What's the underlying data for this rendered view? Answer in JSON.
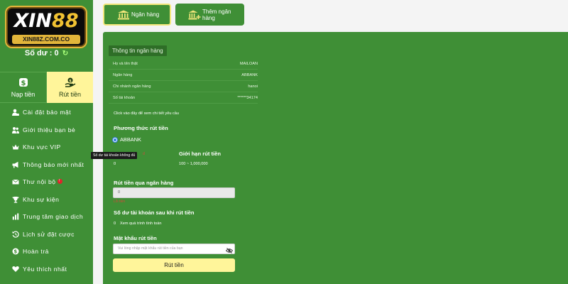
{
  "logo": {
    "brand_main": "XIN",
    "brand_num": "88",
    "domain": "XIN88Z.COM.CO"
  },
  "balance": {
    "label": "Số dư : 0",
    "refresh_icon": "refresh-icon"
  },
  "tabs": [
    {
      "label": "Nạp tiền",
      "icon": "dollar-coin-icon"
    },
    {
      "label": "Rút tiền",
      "icon": "hand-money-icon"
    }
  ],
  "menu": [
    {
      "label": "Cài đặt bảo mật",
      "icon": "user-lock-icon"
    },
    {
      "label": "Giới thiệu bạn bè",
      "icon": "users-icon"
    },
    {
      "label": "Khu vực VIP",
      "icon": "crown-icon"
    },
    {
      "label": "Thông báo mới nhất",
      "icon": "megaphone-icon"
    },
    {
      "label": "Thư nội bộ",
      "icon": "envelope-icon",
      "badge": "!"
    },
    {
      "label": "Khu sự kiện",
      "icon": "trophy-icon"
    },
    {
      "label": "Trung tâm giao dịch",
      "icon": "chart-icon"
    },
    {
      "label": "Lịch sử đặt cược",
      "icon": "history-icon"
    },
    {
      "label": "Hoàn trả",
      "icon": "coin-return-icon"
    },
    {
      "label": "Yêu thích nhất",
      "icon": "heart-icon"
    }
  ],
  "top_buttons": [
    {
      "label": "Ngân hàng",
      "icon": "bank-icon"
    },
    {
      "label": "Thêm ngân hàng",
      "icon": "bank-add-icon"
    }
  ],
  "bank_info": {
    "section_title": "Thông tin ngân hàng",
    "rows": [
      {
        "label": "Họ và tên thật",
        "value": "MAILOAN"
      },
      {
        "label": "Ngân hàng",
        "value": "ABBANK"
      },
      {
        "label": "Chi nhánh ngân hàng",
        "value": "hanoi"
      },
      {
        "label": "Số tài khoản",
        "value": "******34174"
      }
    ],
    "click_hint": "Click vào đây để xem chi tiết yêu cầu"
  },
  "withdraw": {
    "method_title": "Phương thức rút tiền",
    "method_selected": "ABBANK",
    "tooltip": "Số dư tài khoản không đủ",
    "error_fragment": "đ",
    "min_value": "0",
    "limit_title": "Giới hạn rút tiền",
    "limit_value": "100 ~ 1,000,000",
    "bank_withdraw_title": "Rút tiền qua ngân hàng",
    "amount_value": "0",
    "amount_error": "Lỗi tiền",
    "after_balance_title": "Số dư tài khoản sau khi rút tiền",
    "after_balance_value": "0",
    "after_balance_note": "Xem quá trình tính toán",
    "password_title": "Mật khẩu rút tiền",
    "password_placeholder": "Vui lòng nhập mật khẩu rút tiền của bạn",
    "submit_label": "Rút tiền"
  },
  "colors": {
    "green": "#3f8f36",
    "yellow": "#fff59a",
    "gold": "#e2b53a"
  }
}
